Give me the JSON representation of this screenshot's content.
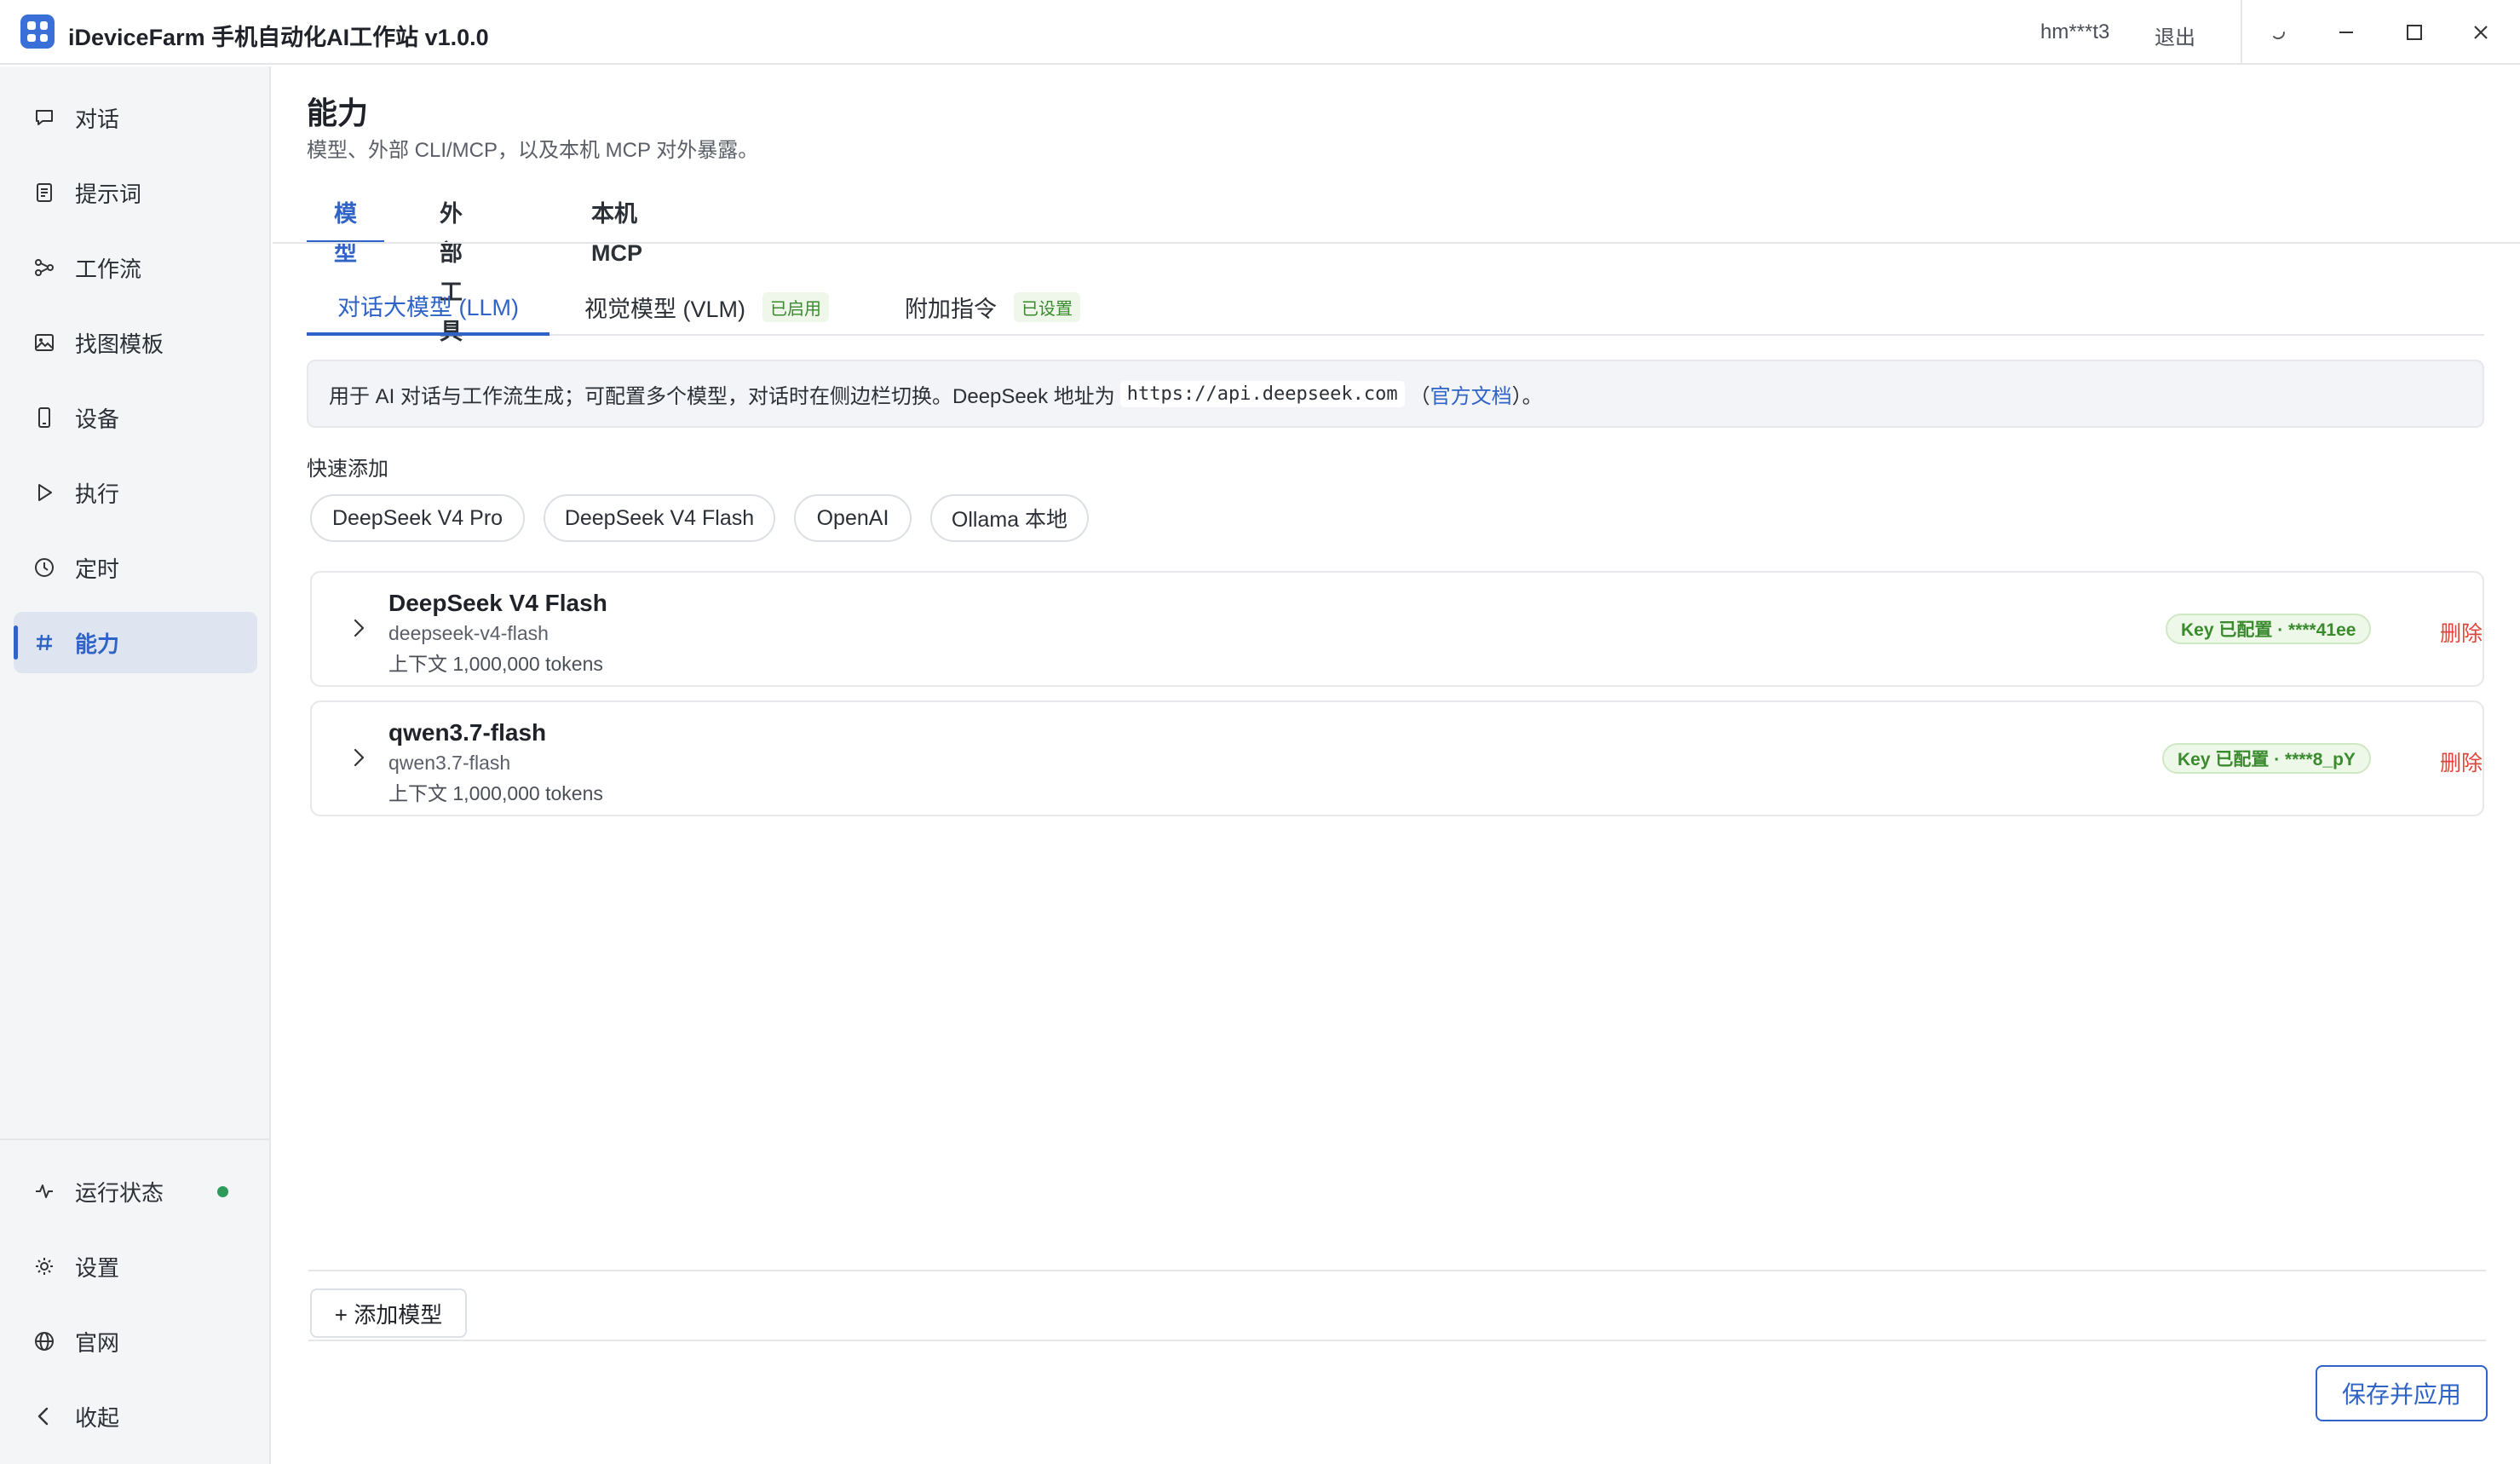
{
  "app": {
    "title": "iDeviceFarm 手机自动化AI工作站 v1.0.0",
    "user": "hm***t3",
    "logout": "退出"
  },
  "sidebar": {
    "items": [
      {
        "label": "对话",
        "icon": "chat-icon"
      },
      {
        "label": "提示词",
        "icon": "document-icon"
      },
      {
        "label": "工作流",
        "icon": "workflow-icon"
      },
      {
        "label": "找图模板",
        "icon": "image-icon"
      },
      {
        "label": "设备",
        "icon": "phone-icon"
      },
      {
        "label": "执行",
        "icon": "play-icon"
      },
      {
        "label": "定时",
        "icon": "clock-icon"
      },
      {
        "label": "能力",
        "icon": "hash-icon",
        "active": true
      }
    ],
    "bottom": [
      {
        "label": "运行状态",
        "icon": "activity-icon",
        "status": "online"
      },
      {
        "label": "设置",
        "icon": "gear-icon"
      },
      {
        "label": "官网",
        "icon": "globe-icon"
      },
      {
        "label": "收起",
        "icon": "chevron-left-icon"
      }
    ]
  },
  "page": {
    "title": "能力",
    "subtitle": "模型、外部 CLI/MCP，以及本机 MCP 对外暴露。",
    "tabs": [
      "模型",
      "外部工具",
      "本机 MCP"
    ],
    "active_tab": "模型"
  },
  "subtabs": [
    {
      "label": "对话大模型 (LLM)",
      "badge": ""
    },
    {
      "label": "视觉模型 (VLM)",
      "badge": "已启用"
    },
    {
      "label": "附加指令",
      "badge": "已设置"
    }
  ],
  "info": {
    "prefix": "用于 AI 对话与工作流生成；可配置多个模型，对话时在侧边栏切换。DeepSeek 地址为",
    "url": "https://api.deepseek.com",
    "paren_open": "（",
    "link": "官方文档",
    "suffix": "）。"
  },
  "quick_add": {
    "label": "快速添加",
    "chips": [
      "DeepSeek V4 Pro",
      "DeepSeek V4 Flash",
      "OpenAI",
      "Ollama 本地"
    ]
  },
  "models": [
    {
      "name": "DeepSeek V4 Flash",
      "id": "deepseek-v4-flash",
      "context": "上下文 1,000,000 tokens",
      "key_badge": "Key 已配置 · ****41ee",
      "delete": "删除"
    },
    {
      "name": "qwen3.7-flash",
      "id": "qwen3.7-flash",
      "context": "上下文 1,000,000 tokens",
      "key_badge": "Key 已配置 · ****8_pY",
      "delete": "删除"
    }
  ],
  "actions": {
    "add_model": "+ 添加模型",
    "save": "保存并应用"
  },
  "colors": {
    "accent": "#2f63c5",
    "success": "#3a8a2e",
    "danger": "#e0453a"
  }
}
